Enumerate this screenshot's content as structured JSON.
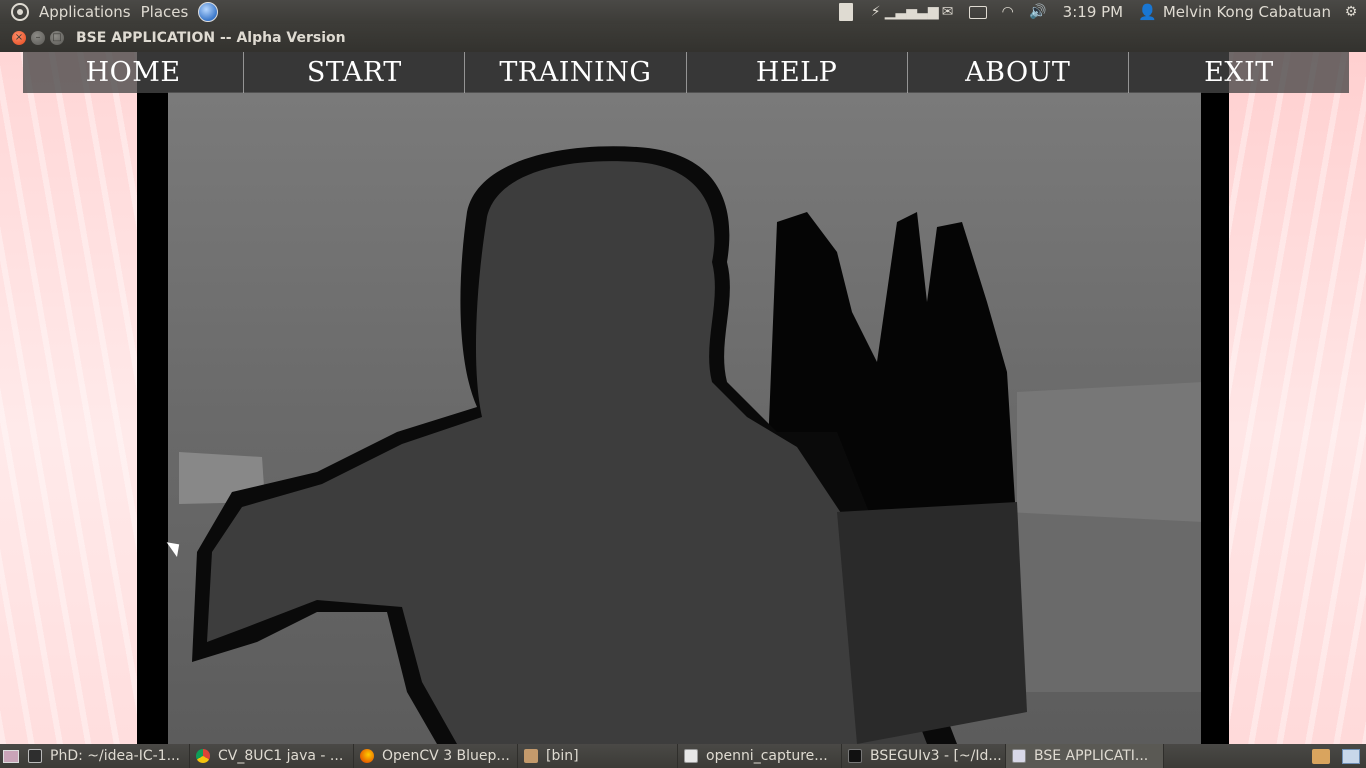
{
  "top_panel": {
    "applications_label": "Applications",
    "places_label": "Places",
    "clock": "3:19 PM",
    "user_name": "Melvin Kong Cabatuan"
  },
  "window": {
    "title": "BSE APPLICATION -- Alpha Version"
  },
  "nav": {
    "items": [
      "HOME",
      "START",
      "TRAINING",
      "HELP",
      "ABOUT",
      "EXIT"
    ]
  },
  "taskbar": {
    "tasks": [
      {
        "label": "PhD: ~/idea-IC-1...",
        "icon": "terminal-icon"
      },
      {
        "label": "CV_8UC1 java - ...",
        "icon": "chrome-icon"
      },
      {
        "label": "OpenCV 3 Bluep...",
        "icon": "firefox-icon"
      },
      {
        "label": "[bin]",
        "icon": "folder-icon"
      },
      {
        "label": "openni_capture...",
        "icon": "text-editor-icon"
      },
      {
        "label": "BSEGUIv3 - [~/Id...",
        "icon": "intellij-icon"
      },
      {
        "label": "BSE APPLICATI...",
        "icon": "window-icon"
      }
    ]
  }
}
